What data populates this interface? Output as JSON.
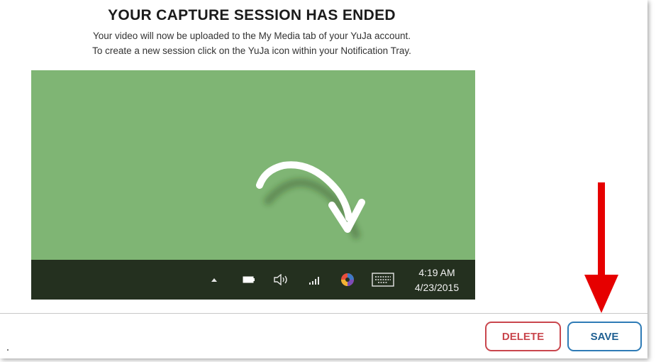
{
  "dialog": {
    "title": "YOUR CAPTURE SESSION HAS ENDED",
    "line1": "Your video will now be uploaded to the My Media tab of your YuJa account.",
    "line2": "To create a new session click on the YuJa icon within your Notification Tray."
  },
  "taskbar": {
    "time": "4:19 AM",
    "date": "4/23/2015",
    "icons": [
      "chevron-up-icon",
      "battery-icon",
      "speaker-icon",
      "network-signal-icon",
      "yuja-icon",
      "keyboard-icon"
    ]
  },
  "buttons": {
    "delete_label": "DELETE",
    "save_label": "SAVE"
  },
  "colors": {
    "preview_background": "#7fb574",
    "taskbar_background": "#24301f",
    "delete_border": "#c9464d",
    "save_border": "#2e7bb6",
    "annotation_arrow": "#e60000"
  }
}
